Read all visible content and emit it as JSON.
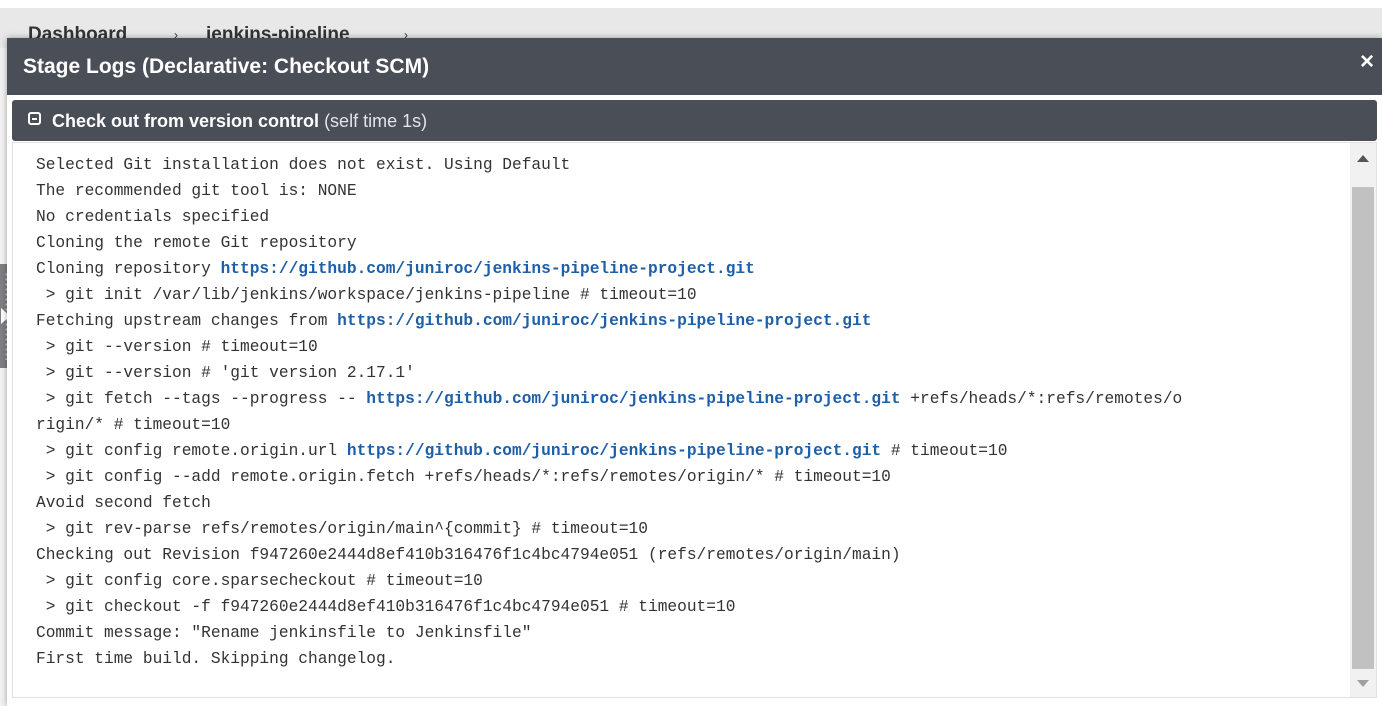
{
  "breadcrumb": {
    "items": [
      "Dashboard",
      "jenkins-pipeline"
    ],
    "separator": "›"
  },
  "modal": {
    "title": "Stage Logs (Declarative: Checkout SCM)",
    "close_icon": "×"
  },
  "step": {
    "title": "Check out from version control",
    "self_time": "(self time 1s)"
  },
  "colors": {
    "header_bg": "#4a4e57",
    "link": "#1f5fa8",
    "log_text": "#333333"
  },
  "log_lines": [
    [
      {
        "t": "Selected Git installation does not exist. Using Default"
      }
    ],
    [
      {
        "t": "The recommended git tool is: NONE"
      }
    ],
    [
      {
        "t": "No credentials specified"
      }
    ],
    [
      {
        "t": "Cloning the remote Git repository"
      }
    ],
    [
      {
        "t": "Cloning repository "
      },
      {
        "t": "https://github.com/juniroc/jenkins-pipeline-project.git",
        "link": true
      }
    ],
    [
      {
        "t": " > git init /var/lib/jenkins/workspace/jenkins-pipeline # timeout=10"
      }
    ],
    [
      {
        "t": "Fetching upstream changes from "
      },
      {
        "t": "https://github.com/juniroc/jenkins-pipeline-project.git",
        "link": true
      }
    ],
    [
      {
        "t": " > git --version # timeout=10"
      }
    ],
    [
      {
        "t": " > git --version # 'git version 2.17.1'"
      }
    ],
    [
      {
        "t": " > git fetch --tags --progress -- "
      },
      {
        "t": "https://github.com/juniroc/jenkins-pipeline-project.git",
        "link": true
      },
      {
        "t": " +refs/heads/*:refs/remotes/o"
      }
    ],
    [
      {
        "t": "rigin/* # timeout=10"
      }
    ],
    [
      {
        "t": " > git config remote.origin.url "
      },
      {
        "t": "https://github.com/juniroc/jenkins-pipeline-project.git",
        "link": true
      },
      {
        "t": " # timeout=10"
      }
    ],
    [
      {
        "t": " > git config --add remote.origin.fetch +refs/heads/*:refs/remotes/origin/* # timeout=10"
      }
    ],
    [
      {
        "t": "Avoid second fetch"
      }
    ],
    [
      {
        "t": " > git rev-parse refs/remotes/origin/main^{commit} # timeout=10"
      }
    ],
    [
      {
        "t": "Checking out Revision f947260e2444d8ef410b316476f1c4bc4794e051 (refs/remotes/origin/main)"
      }
    ],
    [
      {
        "t": " > git config core.sparsecheckout # timeout=10"
      }
    ],
    [
      {
        "t": " > git checkout -f f947260e2444d8ef410b316476f1c4bc4794e051 # timeout=10"
      }
    ],
    [
      {
        "t": "Commit message: \"Rename jenkinsfile to Jenkinsfile\""
      }
    ],
    [
      {
        "t": "First time build. Skipping changelog."
      }
    ]
  ]
}
